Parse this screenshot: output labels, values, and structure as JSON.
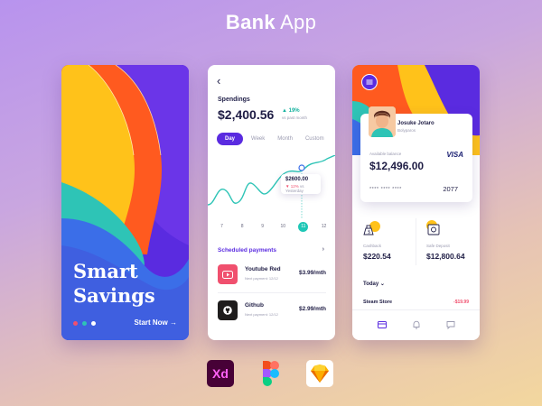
{
  "header": {
    "title_bold": "Bank",
    "title_light": " App"
  },
  "screen1": {
    "heading_line1": "Smart",
    "heading_line2": "Savings",
    "start_label": "Start Now →",
    "dots": [
      "#f0506e",
      "#2ec4b6",
      "#ffffff"
    ]
  },
  "screen2": {
    "back_icon": "‹",
    "spendings_label": "Spendings",
    "amount": "$2,400.56",
    "change_pct": "▲ 19%",
    "change_sub": "vs past month",
    "tabs": [
      "Day",
      "Week",
      "Month",
      "Custom"
    ],
    "active_tab": "Day",
    "tooltip_value": "$2600.00",
    "tooltip_pct": "▼ 12%",
    "tooltip_sub": "vs Yesterday",
    "x_labels": [
      "7",
      "8",
      "9",
      "10",
      "11",
      "12"
    ],
    "selected_x": "11",
    "scheduled_label": "Scheduled payments",
    "scheduled_arrow": "›",
    "payments": [
      {
        "name": "Youtube Red",
        "next": "Next payment: 12/12",
        "amount": "$3.99/mth",
        "icon": "youtube-icon"
      },
      {
        "name": "Github",
        "next": "Next payment: 12/12",
        "amount": "$2.99/mth",
        "icon": "github-icon"
      }
    ]
  },
  "screen3": {
    "user_name": "Josuke Jotaro",
    "user_role": "Bolyparos",
    "balance_label": "Available balance",
    "balance": "$12,496.00",
    "card_brand": "VISA",
    "card_masked": "****   ****   ****",
    "card_last4": "2077",
    "stats": [
      {
        "label": "Cashback",
        "value": "$220.54",
        "icon": "money-bag-icon"
      },
      {
        "label": "Safe Deposit",
        "value": "$12,800.64",
        "icon": "safe-icon"
      }
    ],
    "today_label": "Today ⌄",
    "transaction_name": "Steam Store",
    "transaction_amount": "-$19.99"
  },
  "tools": {
    "xd_label": "Xd"
  },
  "colors": {
    "purple": "#5a2be0",
    "orange": "#ff5a1f",
    "yellow": "#ffc21a",
    "teal": "#2ec4b6",
    "blue": "#3b6ee8",
    "red": "#f0506e"
  }
}
